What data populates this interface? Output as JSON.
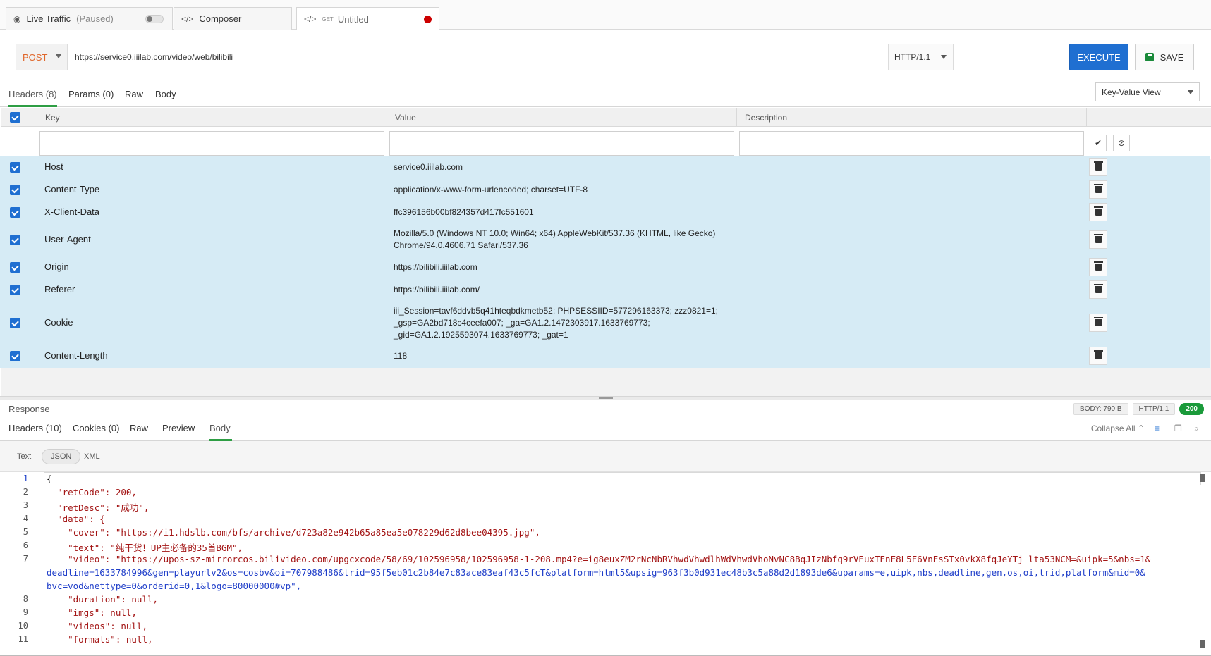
{
  "tabs": {
    "live_traffic": {
      "label": "Live Traffic",
      "status": "(Paused)",
      "icon": "eye-icon"
    },
    "composer": {
      "label": "Composer",
      "icon": "code-icon"
    },
    "untitled": {
      "method_pill": "GET",
      "label": "Untitled",
      "icon": "code-icon",
      "dirty_color": "#cc0000"
    }
  },
  "request": {
    "method": "POST",
    "url": "https://service0.iiilab.com/video/web/bilibili",
    "protocol": "HTTP/1.1",
    "execute_label": "EXECUTE",
    "save_label": "SAVE"
  },
  "request_tabs": {
    "headers": "Headers (8)",
    "params": "Params (0)",
    "raw": "Raw",
    "body": "Body",
    "view_mode": "Key-Value View"
  },
  "headers_table": {
    "columns": {
      "key": "Key",
      "value": "Value",
      "description": "Description"
    },
    "rows": [
      {
        "key": "Host",
        "value": "service0.iiilab.com",
        "checked": true
      },
      {
        "key": "Content-Type",
        "value": "application/x-www-form-urlencoded; charset=UTF-8",
        "checked": true
      },
      {
        "key": "X-Client-Data",
        "value": "ffc396156b00bf824357d417fc551601",
        "checked": true
      },
      {
        "key": "User-Agent",
        "value": "Mozilla/5.0 (Windows NT 10.0; Win64; x64) AppleWebKit/537.36 (KHTML, like Gecko) Chrome/94.0.4606.71 Safari/537.36",
        "checked": true
      },
      {
        "key": "Origin",
        "value": "https://bilibili.iiilab.com",
        "checked": true
      },
      {
        "key": "Referer",
        "value": "https://bilibili.iiilab.com/",
        "checked": true
      },
      {
        "key": "Cookie",
        "value": "iii_Session=tavf6ddvb5q41hteqbdkmetb52; PHPSESSIID=577296163373; zzz0821=1; _gsp=GA2bd718c4ceefa007; _ga=GA1.2.1472303917.1633769773; _gid=GA1.2.1925593074.1633769773; _gat=1",
        "checked": true
      },
      {
        "key": "Content-Length",
        "value": "118",
        "checked": true
      }
    ]
  },
  "response": {
    "title": "Response",
    "body_size": "BODY: 790 B",
    "protocol": "HTTP/1.1",
    "status": "200",
    "status_color": "#1a9a3a",
    "tabs": {
      "headers": "Headers (10)",
      "cookies": "Cookies (0)",
      "raw": "Raw",
      "preview": "Preview",
      "body": "Body"
    },
    "collapse_all": "Collapse All",
    "formats": {
      "text": "Text",
      "json": "JSON",
      "xml": "XML"
    },
    "code_lines": [
      {
        "n": "1",
        "text": "{"
      },
      {
        "n": "2",
        "text": "  \"retCode\": 200,"
      },
      {
        "n": "3",
        "text": "  \"retDesc\": \"成功\","
      },
      {
        "n": "4",
        "text": "  \"data\": {"
      },
      {
        "n": "5",
        "text": "    \"cover\": \"https://i1.hdslb.com/bfs/archive/d723a82e942b65a85ea5e078229d62d8bee04395.jpg\","
      },
      {
        "n": "6",
        "text": "    \"text\": \"纯干货！UP主必备的35首BGM\","
      },
      {
        "n": "7",
        "text": "    \"video\": \"https://upos-sz-mirrorcos.bilivideo.com/upgcxcode/58/69/102596958/102596958-1-208.mp4?e=ig8euxZM2rNcNbRVhwdVhwdlhWdVhwdVhoNvNC8BqJIzNbfq9rVEuxTEnE8L5F6VnEsSTx0vkX8fqJeYTj_lta53NCM=&uipk=5&nbs=1&"
      },
      {
        "n": "",
        "text": "deadline=1633784996&gen=playurlv2&os=cosbv&oi=707988486&trid=95f5eb01c2b84e7c83ace83eaf43c5fcT&platform=html5&upsig=963f3b0d931ec48b3c5a88d2d1893de6&uparams=e,uipk,nbs,deadline,gen,os,oi,trid,platform&mid=0&"
      },
      {
        "n": "",
        "text": "bvc=vod&nettype=0&orderid=0,1&logo=80000000#vp\","
      },
      {
        "n": "8",
        "text": "    \"duration\": null,"
      },
      {
        "n": "9",
        "text": "    \"imgs\": null,"
      },
      {
        "n": "10",
        "text": "    \"videos\": null,"
      },
      {
        "n": "11",
        "text": "    \"formats\": null,"
      }
    ]
  }
}
